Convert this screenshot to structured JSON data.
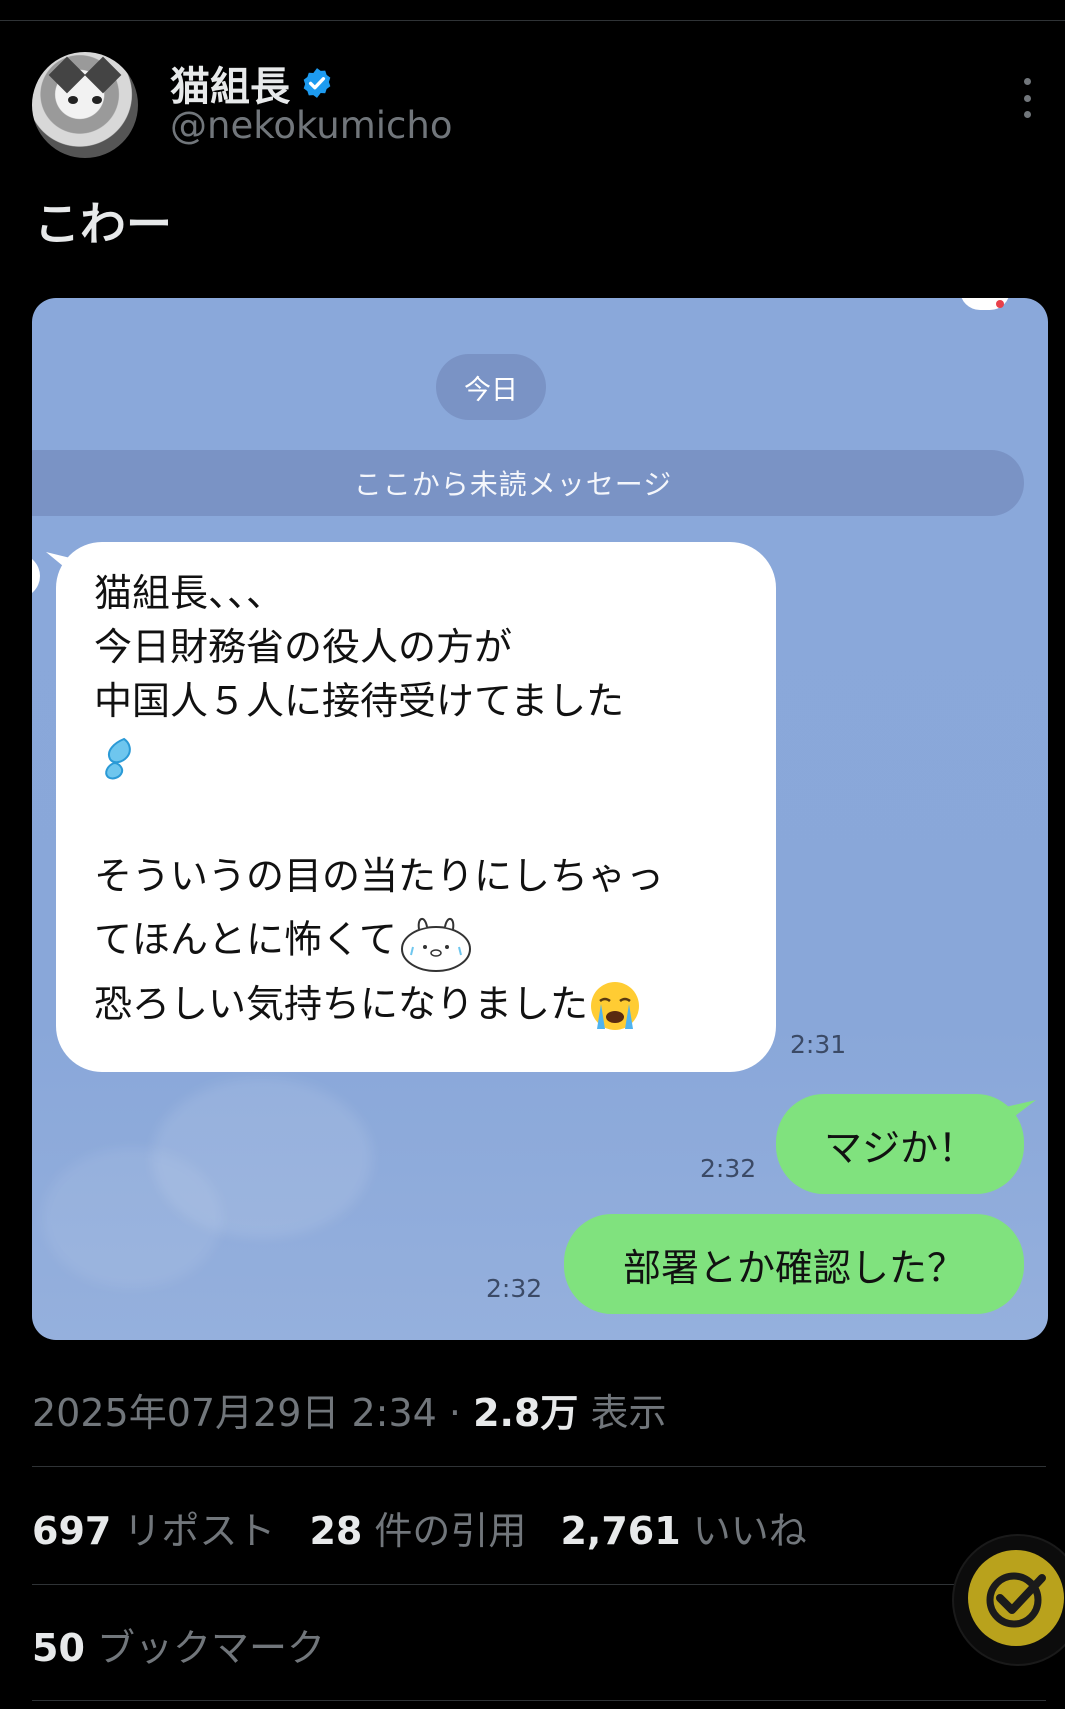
{
  "tweet": {
    "display_name": "猫組長",
    "handle": "@nekokumicho",
    "text": "こわー",
    "timestamp": "2025年07月29日 2:34",
    "views_count": "2.8万",
    "views_label": "表示",
    "reposts_count": "697",
    "reposts_label": "リポスト",
    "quotes_count": "28",
    "quotes_label": "件の引用",
    "likes_count": "2,761",
    "likes_label": "いいね",
    "bookmarks_count": "50",
    "bookmarks_label": "ブックマーク",
    "verified_color": "#1d9bf0",
    "icons": [
      "verified-badge-icon",
      "more-options-icon",
      "avatar",
      "check-fab-icon"
    ]
  },
  "chat": {
    "date_label": "今日",
    "unread_label": "ここから未読メッセージ",
    "incoming": {
      "lines": [
        "猫組長、、、",
        "今日財務省の役人の方が",
        "中国人５人に接待受けてました",
        "",
        "",
        "そういうの目の当たりにしちゃっ",
        "てほんとに怖くて",
        "恐ろしい気持ちになりました"
      ],
      "time": "2:31",
      "icons": [
        "sweat-drops-icon",
        "crying-bunny-icon",
        "loudly-crying-face-icon"
      ]
    },
    "outgoing": [
      {
        "text": "マジか！",
        "time": "2:32"
      },
      {
        "text": "部署とか確認した？",
        "time": "2:32"
      }
    ],
    "bg_color": "#8aa8da",
    "outgoing_color": "#80e27e"
  }
}
